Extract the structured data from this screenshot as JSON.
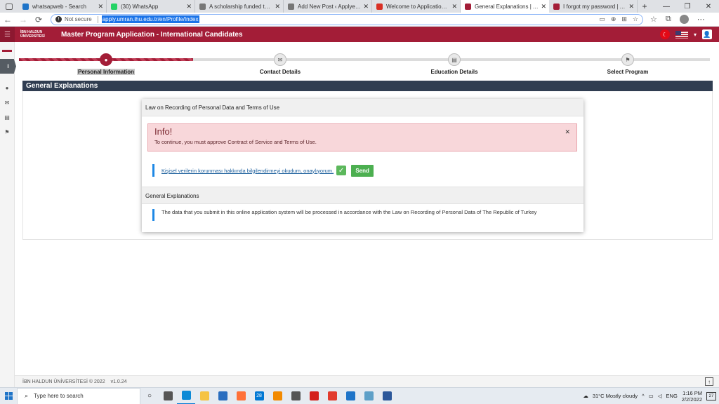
{
  "browser": {
    "tabs": [
      {
        "title": "whatsapweb - Search",
        "icon": "bing-icon",
        "color": "#1e74c8",
        "active": false
      },
      {
        "title": "(30) WhatsApp",
        "icon": "whatsapp-icon",
        "color": "#25d366",
        "active": false
      },
      {
        "title": "A scholarship funded to study at",
        "icon": "page-icon",
        "color": "#777777",
        "active": false
      },
      {
        "title": "Add New Post ‹ Applyen — Wo",
        "icon": "page-icon",
        "color": "#777777",
        "active": false
      },
      {
        "title": "Welcome to Application System",
        "icon": "gmail-icon",
        "color": "#d93025",
        "active": false
      },
      {
        "title": "General Explanations | Apply | U",
        "icon": "ihu-icon",
        "color": "#a31d37",
        "active": true
      },
      {
        "title": "I forgot my password | Apply | U",
        "icon": "ihu-icon",
        "color": "#a31d37",
        "active": false
      }
    ],
    "security_label": "Not secure",
    "url": "apply.umran.ihu.edu.tr/en/Profile/Index"
  },
  "header": {
    "logo_text": "İBN HALDUN ÜNİVERSİTESİ",
    "title": "Master Program Application - International Candidates"
  },
  "stepper": {
    "steps": [
      {
        "label": "Personal Information",
        "icon": "user-icon",
        "glyph": "●",
        "active": true
      },
      {
        "label": "Contact Details",
        "icon": "envelope-icon",
        "glyph": "✉",
        "active": false
      },
      {
        "label": "Education Details",
        "icon": "book-icon",
        "glyph": "▤",
        "active": false
      },
      {
        "label": "Select Program",
        "icon": "flag-icon",
        "glyph": "⚑",
        "active": false
      }
    ]
  },
  "section": {
    "title": "General Explanations"
  },
  "modal": {
    "title": "Law on Recording of Personal Data and Terms of Use",
    "alert_title": "Info!",
    "alert_message": "To continue, you must approve Contract of Service and Terms of Use.",
    "consent_link": "Kişisel verilerin korunması hakkında bilgilendirmeyi okudum, onaylıyorum.",
    "consent_checked": true,
    "send_label": "Send",
    "section2_title": "General Explanations",
    "section2_text": "The data that you submit in this online application system will be processed in accordance with the Law on Recording of Personal Data of The Republic of Turkey"
  },
  "footer": {
    "copyright": "İBN HALDUN ÜNİVERSİTESİ © 2022",
    "version": "v1.0.24"
  },
  "taskbar": {
    "search_placeholder": "Type here to search",
    "apps": [
      {
        "name": "task-view-icon",
        "color": "#555555"
      },
      {
        "name": "edge-icon",
        "color": "#0c8ad6",
        "running": true
      },
      {
        "name": "file-explorer-icon",
        "color": "#f5c342"
      },
      {
        "name": "store-icon",
        "color": "#2a6ebf"
      },
      {
        "name": "firefox-icon",
        "color": "#ff7139"
      },
      {
        "name": "mail-icon",
        "color": "#0078d4",
        "badge": "28"
      },
      {
        "name": "vlc-icon",
        "color": "#f28a00"
      },
      {
        "name": "media-icon",
        "color": "#555555"
      },
      {
        "name": "acrobat-icon",
        "color": "#d4201b"
      },
      {
        "name": "anydesk-icon",
        "color": "#e23b2e"
      },
      {
        "name": "network-icon",
        "color": "#1e74c8"
      },
      {
        "name": "photos-icon",
        "color": "#5ea0c8"
      },
      {
        "name": "word-icon",
        "color": "#2b579a"
      }
    ],
    "weather": "31°C  Mostly cloudy",
    "language": "ENG",
    "time": "1:16 PM",
    "date": "2/2/2022",
    "notifications": "27"
  }
}
